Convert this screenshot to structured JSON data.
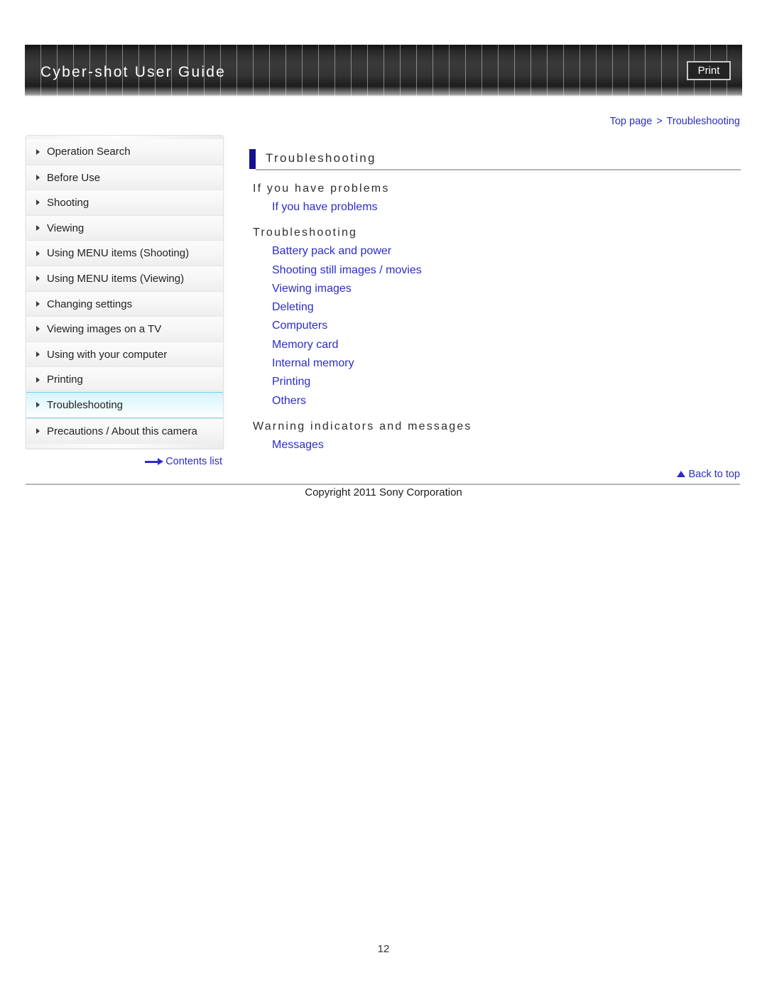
{
  "header": {
    "title": "Cyber-shot User Guide",
    "print_label": "Print"
  },
  "breadcrumb": {
    "top_page": "Top page",
    "separator": ">",
    "current": "Troubleshooting"
  },
  "sidebar": {
    "items": [
      {
        "label": "Operation Search",
        "selected": false
      },
      {
        "label": "Before Use",
        "selected": false
      },
      {
        "label": "Shooting",
        "selected": false
      },
      {
        "label": "Viewing",
        "selected": false
      },
      {
        "label": "Using MENU items (Shooting)",
        "selected": false
      },
      {
        "label": "Using MENU items (Viewing)",
        "selected": false
      },
      {
        "label": "Changing settings",
        "selected": false
      },
      {
        "label": "Viewing images on a TV",
        "selected": false
      },
      {
        "label": "Using with your computer",
        "selected": false
      },
      {
        "label": "Printing",
        "selected": false
      },
      {
        "label": "Troubleshooting",
        "selected": true
      },
      {
        "label": "Precautions / About this camera",
        "selected": false
      }
    ],
    "contents_list_label": "Contents list"
  },
  "main": {
    "page_title": "Troubleshooting",
    "sections": [
      {
        "heading": "If you have problems",
        "links": [
          "If you have problems"
        ]
      },
      {
        "heading": "Troubleshooting",
        "links": [
          "Battery pack and power",
          "Shooting still images / movies",
          "Viewing images",
          "Deleting",
          "Computers",
          "Memory card",
          "Internal memory",
          "Printing",
          "Others"
        ]
      },
      {
        "heading": "Warning indicators and messages",
        "links": [
          "Messages"
        ]
      }
    ]
  },
  "footer": {
    "back_to_top_label": "Back to top",
    "copyright": "Copyright 2011 Sony Corporation",
    "page_number": "12"
  },
  "colors": {
    "link_blue": "#2c2cc8",
    "title_bar_navy": "#12128f",
    "selected_cyan": "#6fd3e8",
    "rule_gray": "#b5b5b5"
  }
}
